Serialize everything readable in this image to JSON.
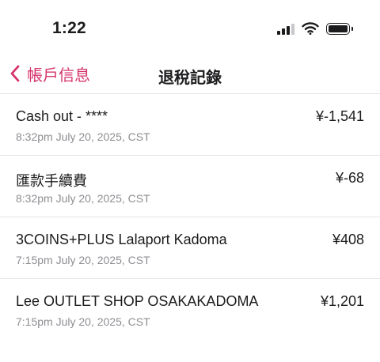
{
  "status_bar": {
    "time": "1:22",
    "icons": [
      "signal-icon",
      "wifi-icon",
      "battery-icon"
    ]
  },
  "nav": {
    "back_label": "帳戶信息",
    "title": "退稅記錄",
    "accent_color": "#d6336c"
  },
  "transactions": [
    {
      "title": "Cash out - ****",
      "datetime": "8:32pm July 20, 2025, CST",
      "amount": "¥-1,541"
    },
    {
      "title": "匯款手續費",
      "datetime": "8:32pm July 20, 2025, CST",
      "amount": "¥-68"
    },
    {
      "title": "3COINS+PLUS Lalaport Kadoma",
      "datetime": "7:15pm July 20, 2025, CST",
      "amount": "¥408"
    },
    {
      "title": "Lee OUTLET SHOP OSAKAKADOMA",
      "datetime": "7:15pm July 20, 2025, CST",
      "amount": "¥1,201"
    }
  ]
}
